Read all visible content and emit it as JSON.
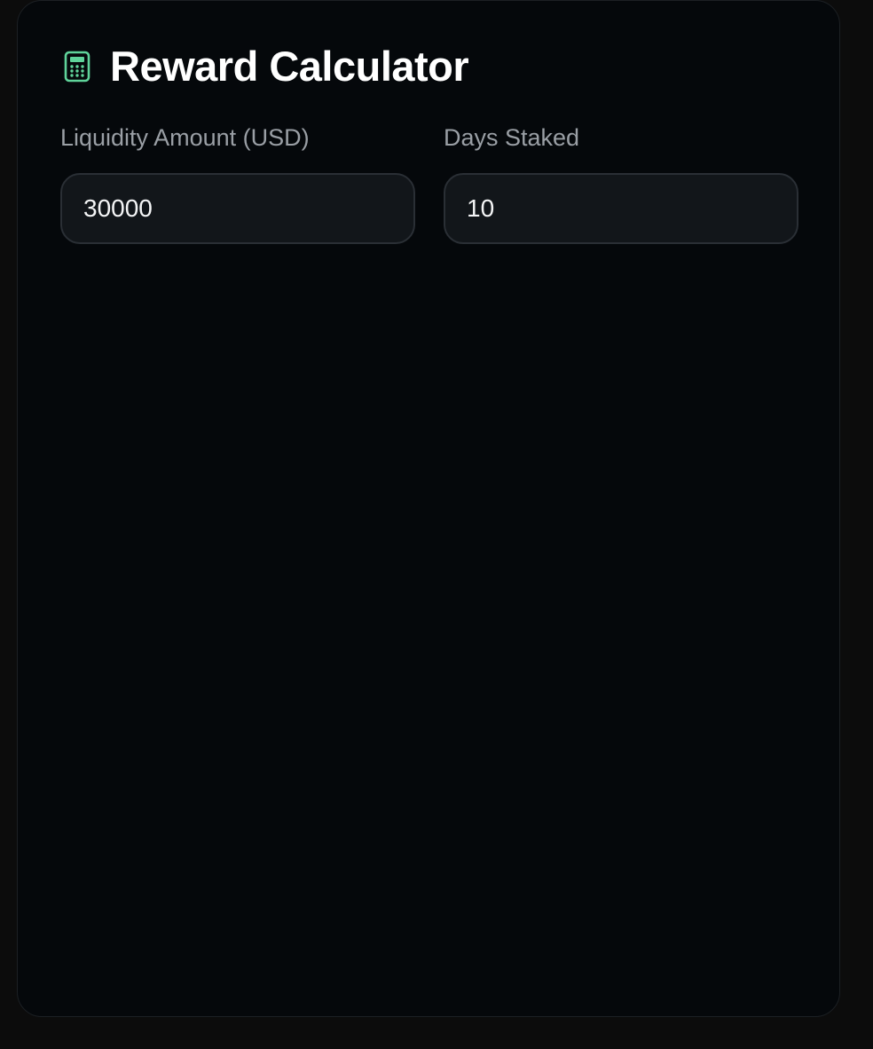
{
  "calculator": {
    "title": "Reward Calculator",
    "icon": "calculator-icon",
    "accent_color": "#5fd39a",
    "liquidity": {
      "label": "Liquidity Amount (USD)",
      "value": "30000"
    },
    "days": {
      "label": "Days Staked",
      "value": "10"
    }
  }
}
